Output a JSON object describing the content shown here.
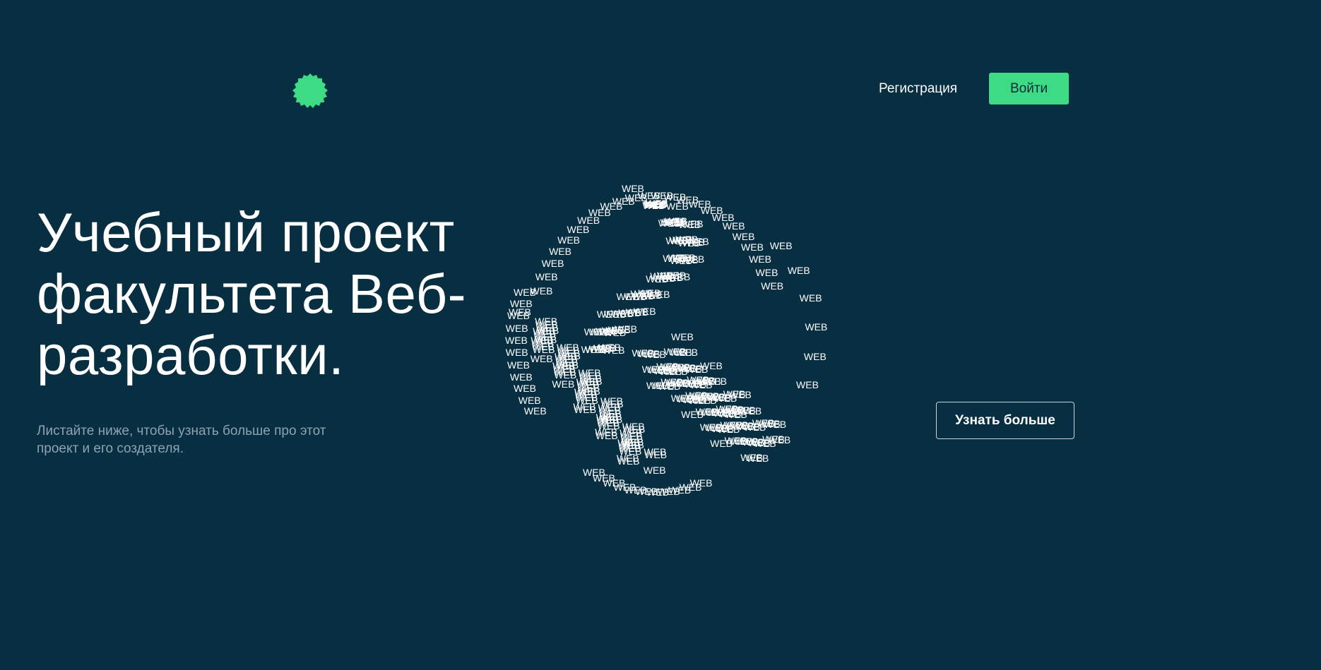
{
  "header": {
    "logo_icon": "green-badge-icon",
    "logo_color": "#3ddc84",
    "register_label": "Регистрация",
    "login_label": "Войти"
  },
  "hero": {
    "title": "Учебный проект факультета Веб-разработки.",
    "subtitle": "Листайте ниже, чтобы узнать больше про этот проект и его создателя.",
    "cta_label": "Узнать больше"
  },
  "word_cloud": {
    "word": "WEB"
  },
  "colors": {
    "background": "#082e42",
    "accent": "#3ddc84",
    "subtitle": "#8ea3b0"
  }
}
